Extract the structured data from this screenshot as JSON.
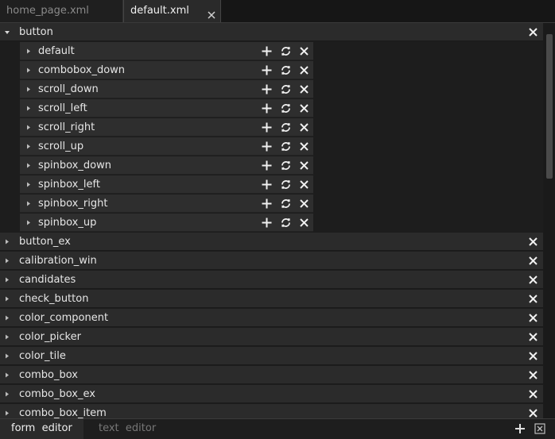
{
  "tabs": [
    {
      "label": "home_page.xml",
      "active": false
    },
    {
      "label": "default.xml",
      "active": true
    }
  ],
  "tree": {
    "expanded_group": {
      "label": "button",
      "children": [
        "default",
        "combobox_down",
        "scroll_down",
        "scroll_left",
        "scroll_right",
        "scroll_up",
        "spinbox_down",
        "spinbox_left",
        "spinbox_right",
        "spinbox_up"
      ]
    },
    "collapsed_groups": [
      "button_ex",
      "calibration_win",
      "candidates",
      "check_button",
      "color_component",
      "color_picker",
      "color_tile",
      "combo_box",
      "combo_box_ex",
      "combo_box_item"
    ]
  },
  "bottom_tabs": [
    {
      "label": "form  editor",
      "active": true
    },
    {
      "label": "text  editor",
      "active": false
    }
  ],
  "icons": {
    "expanded": "triangle-down-icon",
    "collapsed": "triangle-right-icon",
    "add": "plus-icon",
    "reset": "refresh-icon",
    "remove": "close-icon"
  },
  "colors": {
    "background": "#1d1d1d",
    "row_top": "#2b2b2b",
    "row_child": "#2e2e2e",
    "text": "#e6e6e6"
  }
}
